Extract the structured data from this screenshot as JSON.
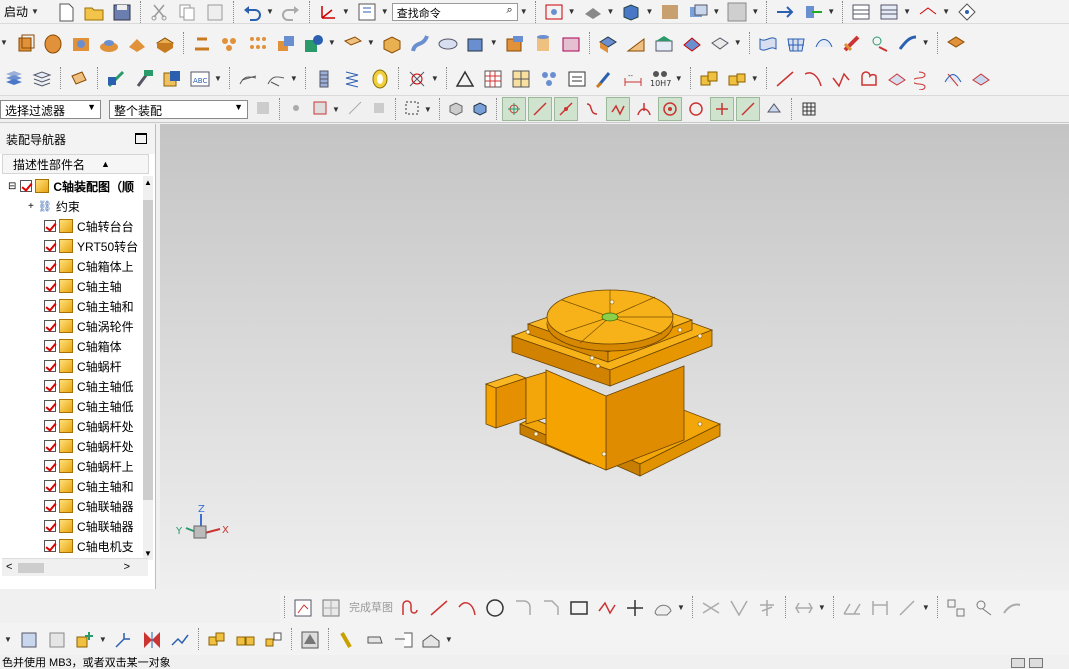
{
  "toolbar": {
    "start_label": "启动",
    "search_placeholder": "查找命令"
  },
  "selection_bar": {
    "filter_value": "选择过滤器",
    "scope_value": "整个装配"
  },
  "navigator": {
    "title": "装配导航器",
    "column_header": "描述性部件名",
    "root_label": "C轴装配图（顺",
    "items": [
      {
        "label": "约束"
      },
      {
        "label": "C轴转台台"
      },
      {
        "label": "YRT50转台"
      },
      {
        "label": "C轴箱体上"
      },
      {
        "label": "C轴主轴"
      },
      {
        "label": "C轴主轴和"
      },
      {
        "label": "C轴涡轮件"
      },
      {
        "label": "C轴箱体"
      },
      {
        "label": "C轴蜗杆"
      },
      {
        "label": "C轴主轴低"
      },
      {
        "label": "C轴主轴低"
      },
      {
        "label": "C轴蜗杆处"
      },
      {
        "label": "C轴蜗杆处"
      },
      {
        "label": "C轴蜗杆上"
      },
      {
        "label": "C轴主轴和"
      },
      {
        "label": "C轴联轴器"
      },
      {
        "label": "C轴联轴器"
      },
      {
        "label": "C轴电机支"
      }
    ]
  },
  "sketch_bar": {
    "finish_sketch_label": "完成草图"
  },
  "status": {
    "message": "色并使用 MB3，或者双击某一对象"
  },
  "triad": {
    "x": "X",
    "y": "Y",
    "z": "Z"
  },
  "colors": {
    "model_orange": "#f0a000",
    "check_red": "#d00000",
    "viewport_top": "#c4c4c4",
    "viewport_bottom": "#efefef"
  }
}
